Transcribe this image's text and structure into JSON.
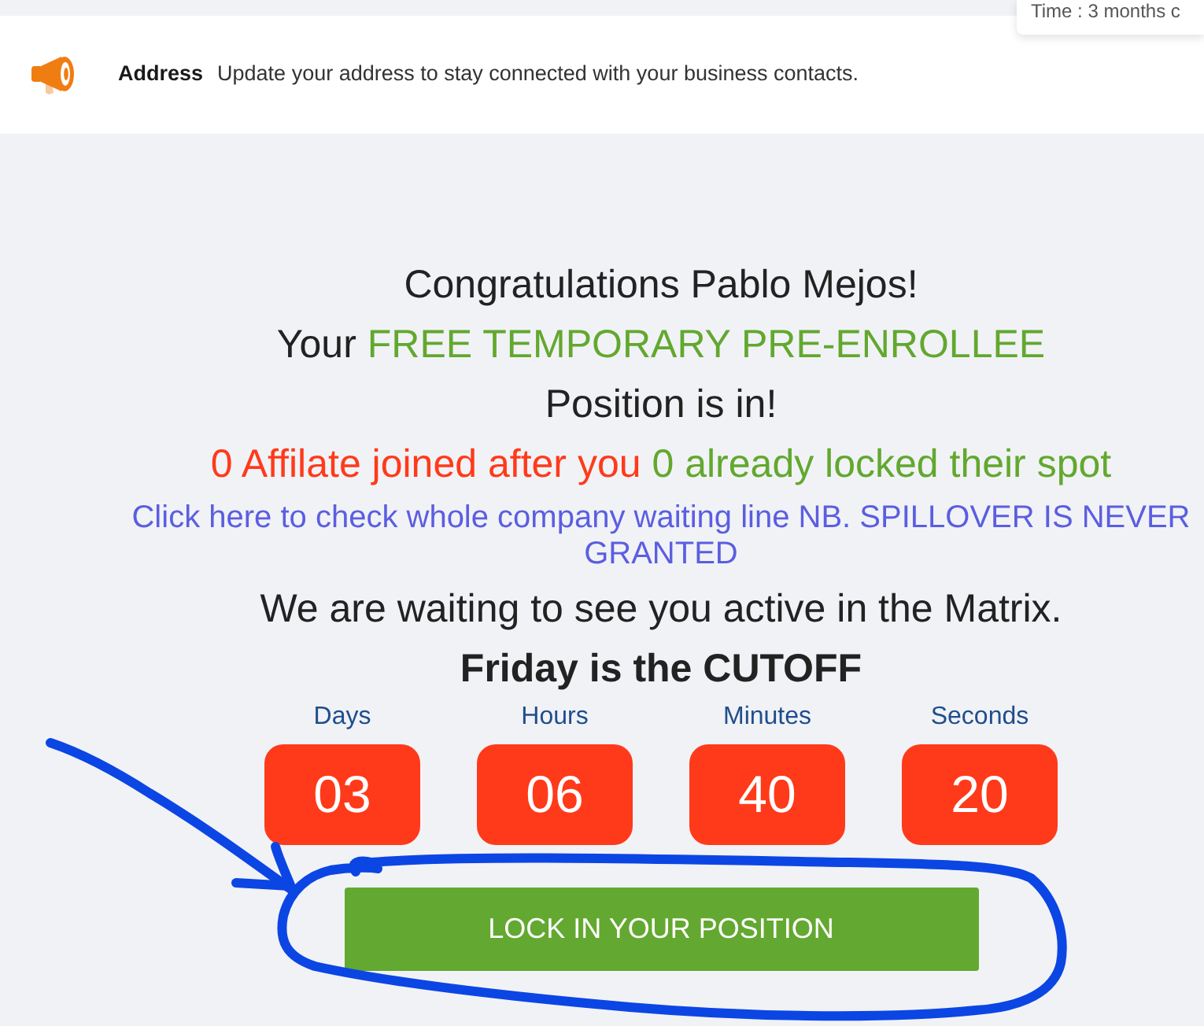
{
  "tooltip": {
    "text": "Time : 3 months c"
  },
  "notice": {
    "title": "Address",
    "message": "Update your address to stay connected with your business contacts."
  },
  "greeting": "Congratulations Pablo Mejos!",
  "position_line": [
    {
      "text": "Your",
      "color": "#222222"
    },
    {
      "text": "FREE TEMPORARY PRE-ENROLLEE",
      "color": "#62a82e"
    }
  ],
  "position_status": "Position is in!",
  "stats": [
    {
      "text": "0 Affilate joined after you",
      "color": "#ff3a1a"
    },
    {
      "text": "0 already locked their spot",
      "color": "#62a82e"
    }
  ],
  "waiting_line_link": "Click here to check whole company waiting line NB. SPILLOVER IS NEVER GRANTED",
  "activity_message": "We are waiting to see you active in the Matrix.",
  "cutoff_message": "Friday is the CUTOFF",
  "countdown": [
    {
      "label": "Days",
      "value": "03"
    },
    {
      "label": "Hours",
      "value": "06"
    },
    {
      "label": "Minutes",
      "value": "40"
    },
    {
      "label": "Seconds",
      "value": "20"
    }
  ],
  "cta_button": "LOCK IN YOUR POSITION"
}
